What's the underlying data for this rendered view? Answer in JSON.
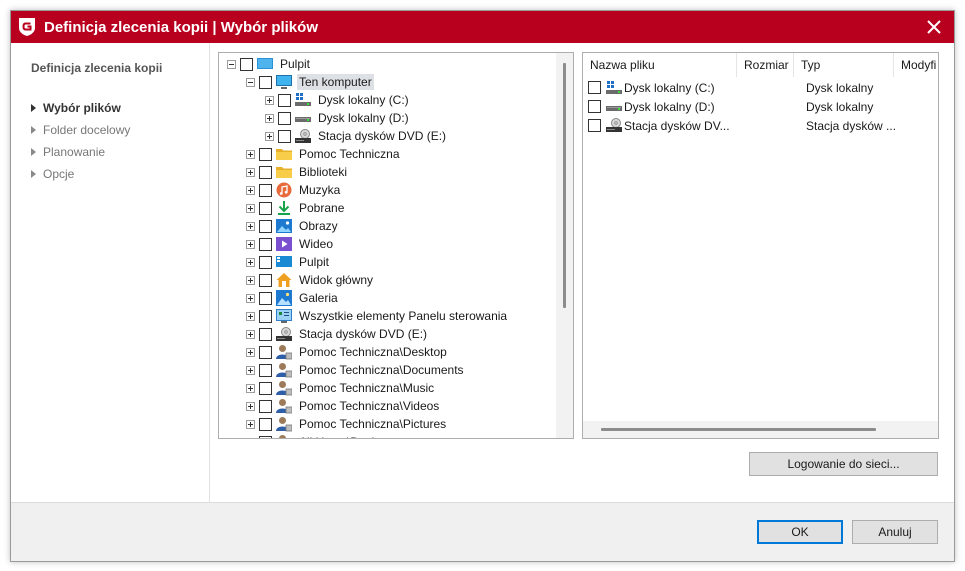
{
  "window": {
    "title": "Definicja zlecenia kopii | Wybór plików",
    "colors": {
      "titlebar": "#b8001e",
      "accent": "#0078d7"
    }
  },
  "sidebar": {
    "heading": "Definicja zlecenia kopii",
    "items": [
      {
        "label": "Wybór plików",
        "active": true
      },
      {
        "label": "Folder docelowy",
        "active": false
      },
      {
        "label": "Planowanie",
        "active": false
      },
      {
        "label": "Opcje",
        "active": false
      }
    ]
  },
  "tree": {
    "items": [
      {
        "label": "Pulpit",
        "icon": "desktop-blue-icon",
        "expander": "minus"
      },
      {
        "label": "Ten komputer",
        "icon": "computer-icon",
        "expander": "minus",
        "selected": true
      },
      {
        "label": "Dysk lokalny (C:)",
        "icon": "windows-drive-icon",
        "expander": "plus"
      },
      {
        "label": "Dysk lokalny (D:)",
        "icon": "drive-icon",
        "expander": "plus"
      },
      {
        "label": "Stacja dysków DVD (E:)",
        "icon": "dvd-drive-icon",
        "expander": "plus"
      },
      {
        "label": "Pomoc Techniczna",
        "icon": "folder-icon",
        "expander": "plus"
      },
      {
        "label": "Biblioteki",
        "icon": "folder-icon",
        "expander": "plus"
      },
      {
        "label": "Muzyka",
        "icon": "music-icon",
        "expander": "plus"
      },
      {
        "label": "Pobrane",
        "icon": "download-icon",
        "expander": "plus"
      },
      {
        "label": "Obrazy",
        "icon": "pictures-icon",
        "expander": "plus"
      },
      {
        "label": "Wideo",
        "icon": "video-icon",
        "expander": "plus"
      },
      {
        "label": "Pulpit",
        "icon": "desktop-icon",
        "expander": "plus"
      },
      {
        "label": "Widok główny",
        "icon": "home-icon",
        "expander": "plus"
      },
      {
        "label": "Galeria",
        "icon": "gallery-icon",
        "expander": "plus"
      },
      {
        "label": "Wszystkie elementy Panelu sterowania",
        "icon": "control-panel-icon",
        "expander": "plus"
      },
      {
        "label": "Stacja dysków DVD (E:)",
        "icon": "dvd-drive-icon",
        "expander": "plus"
      },
      {
        "label": "Pomoc Techniczna\\Desktop",
        "icon": "user-folder-icon",
        "expander": "plus"
      },
      {
        "label": "Pomoc Techniczna\\Documents",
        "icon": "user-folder-icon",
        "expander": "plus"
      },
      {
        "label": "Pomoc Techniczna\\Music",
        "icon": "user-folder-icon",
        "expander": "plus"
      },
      {
        "label": "Pomoc Techniczna\\Videos",
        "icon": "user-folder-icon",
        "expander": "plus"
      },
      {
        "label": "Pomoc Techniczna\\Pictures",
        "icon": "user-folder-icon",
        "expander": "plus"
      },
      {
        "label": "All Users\\Desktop",
        "icon": "user-folder-icon",
        "expander": "plus"
      }
    ]
  },
  "file_list": {
    "columns": [
      "Nazwa pliku",
      "Rozmiar",
      "Typ",
      "Modyfi"
    ],
    "rows": [
      {
        "name": "Dysk lokalny (C:)",
        "size": "",
        "type": "Dysk lokalny",
        "icon": "windows-drive-icon"
      },
      {
        "name": "Dysk lokalny (D:)",
        "size": "",
        "type": "Dysk lokalny",
        "icon": "drive-icon"
      },
      {
        "name": "Stacja dysków DV...",
        "size": "",
        "type": "Stacja dysków ...",
        "icon": "dvd-drive-icon"
      }
    ]
  },
  "buttons": {
    "network_login": "Logowanie do sieci...",
    "ok": "OK",
    "cancel": "Anuluj"
  }
}
